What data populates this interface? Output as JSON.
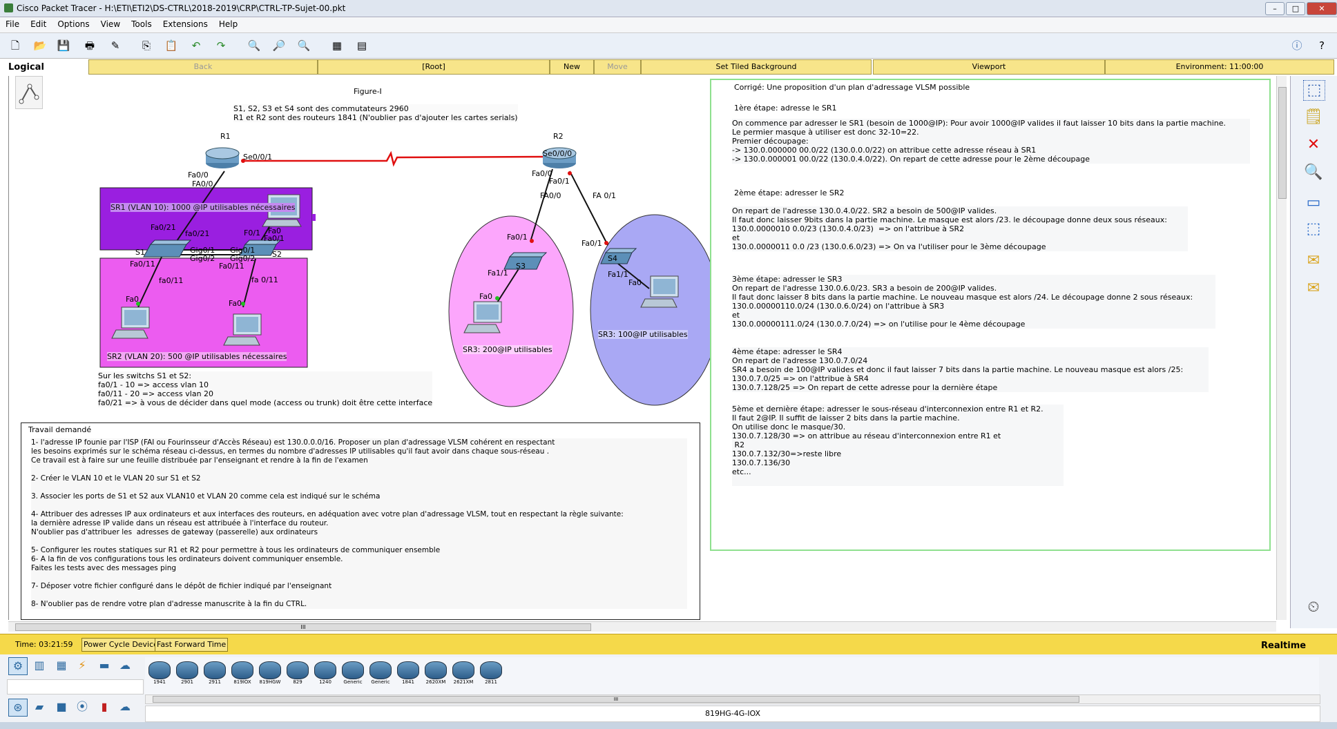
{
  "window": {
    "title": "Cisco Packet Tracer - H:\\ETI\\ETI2\\DS-CTRL\\2018-2019\\CRP\\CTRL-TP-Sujet-00.pkt",
    "minimize": "–",
    "maximize": "□",
    "close": "✕"
  },
  "menu": [
    "File",
    "Edit",
    "Options",
    "View",
    "Tools",
    "Extensions",
    "Help"
  ],
  "logical_bar": {
    "mode": "Logical",
    "back": "Back",
    "root": "[Root]",
    "new_cluster": "New Cluster",
    "move_object": "Move Object",
    "set_tiled_background": "Set Tiled Background",
    "viewport": "Viewport",
    "environment": "Environment: 11:00:00"
  },
  "diagram": {
    "figure_title": "Figure-I",
    "header_text": "S1, S2, S3 et S4 sont des commutateurs 2960\nR1 et R2 sont des routeurs 1841 (N'oublier pas d'ajouter les cartes serials)",
    "r1": "R1",
    "r2": "R2",
    "se001": "Se0/0/1",
    "se000": "Se0/0/0",
    "r1_fa00_a": "Fa0/0",
    "r1_fa00_b": "FA0/0",
    "r2_fa00_a": "Fa0/0",
    "r2_fa01_a": "Fa0/1",
    "r2_fa00_b": "FA0/0",
    "r2_fa01_b": "FA 0/1",
    "sr1": "SR1 (VLAN 10): 1000 @IP utilisables nécessaires",
    "sr2": "SR2 (VLAN 20): 500 @IP utilisables nécessaires",
    "s1": "S1",
    "s2": "S2",
    "s1_fa021": "Fa0/21",
    "s1_fa021b": "fa0/21",
    "f01": "F0/1",
    "fa0_pc": "Fa0",
    "fa01_s2": "Fa0/1",
    "gig01a": "Gig0/1",
    "gig02a": "Gig0/2",
    "gig01b": "Gig0/1",
    "gig02b": "Gig0/2",
    "s1_fa011": "Fa0/11",
    "s1_fa011b": "fa0/11",
    "s2_fa011": "Fa0/11",
    "s2_fa011b": "fa 0/11",
    "pc_fa0_1": "Fa0",
    "pc_fa0_2": "Fa0",
    "s3": "S3",
    "s3_fa01": "Fa0/1",
    "s3_fa11": "Fa1/1",
    "s3_pc_fa0": "Fa0",
    "sr3": "SR3: 200@IP utilisables",
    "s4": "S4",
    "s4_fa01": "Fa0/1",
    "s4_fa11": "Fa1/1",
    "s4_pc_fa0": "Fa0",
    "sr4": "SR3: 100@IP utilisables",
    "switch_note": "Sur les switchs S1 et S2:\nfa0/1 - 10 => access vlan 10\nfa0/11 - 20 => access vlan 20\nfa0/21 => à vous de décider dans quel mode (access ou trunk) doit être cette interface"
  },
  "task": {
    "title": "Travail demandé",
    "body": "1- l'adresse IP founie par l'ISP (FAI ou Fourinsseur d'Accès Réseau) est 130.0.0.0/16. Proposer un plan d'adressage VLSM cohérent en respectant\nles besoins exprimés sur le schéma réseau ci-dessus, en termes du nombre d'adresses IP utilisables qu'il faut avoir dans chaque sous-réseau .\nCe travail est à faire sur une feuille distribuée par l'enseignant et rendre à la fin de l'examen\n\n2- Créer le VLAN 10 et le VLAN 20 sur S1 et S2\n\n3. Associer les ports de S1 et S2 aux VLAN10 et VLAN 20 comme cela est indiqué sur le schéma\n\n4- Attribuer des adresses IP aux ordinateurs et aux interfaces des routeurs, en adéquation avec votre plan d'adressage VLSM, tout en respectant la règle suivante:\nla dernière adresse IP valide dans un réseau est attribuée à l'interface du routeur.\nN'oublier pas d'attribuer les  adresses de gateway (passerelle) aux ordinateurs\n\n5- Configurer les routes statiques sur R1 et R2 pour permettre à tous les ordinateurs de communiquer ensemble\n6- A la fin de vos configurations tous les ordinateurs doivent communiquer ensemble.\nFaites les tests avec des messages ping\n\n7- Déposer votre fichier configuré dans le dépôt de fichier indiqué par l'enseignant\n\n8- N'oublier pas de rendre votre plan d'adresse manuscrite à la fin du CTRL."
  },
  "correction": {
    "title": "Corrigé: Une proposition d'un plan d'adressage VLSM possible",
    "step1_title": "1ère étape: adresse le SR1",
    "step1": "On commence par adresser le SR1 (besoin de 1000@IP): Pour avoir 1000@IP valides il faut laisser 10 bits dans la partie machine.\nLe permier masque à utiliser est donc 32-10=22.\nPremier découpage:\n-> 130.0.000000 00.0/22 (130.0.0.0/22) on attribue cette adresse réseau à SR1\n-> 130.0.000001 00.0/22 (130.0.4.0/22). On repart de cette adresse pour le 2ème découpage",
    "step2_title": "2ème étape: adresser le SR2",
    "step2": "On repart de l'adresse 130.0.4.0/22. SR2 a besoin de 500@IP valides.\nIl faut donc laisser 9bits dans la partie machine. Le masque est alors /23. le découpage donne deux sous réseaux:\n130.0.0000010 0.0/23 (130.0.4.0/23)  => on l'attribue à SR2\net\n130.0.0000011 0.0 /23 (130.0.6.0/23) => On va l'utiliser pour le 3ème découpage",
    "step3": "3ème étape: adresser le SR3\nOn repart de l'adresse 130.0.6.0/23. SR3 a besoin de 200@IP valides.\nIl faut donc laisser 8 bits dans la partie machine. Le nouveau masque est alors /24. Le découpage donne 2 sous réseaux:\n130.0.00000110.0/24 (130.0.6.0/24) on l'attribue à SR3\net\n130.0.00000111.0/24 (130.0.7.0/24) => on l'utilise pour le 4ème découpage",
    "step4": "4ème étape: adresser le SR4\nOn repart de l'adresse 130.0.7.0/24\nSR4 a besoin de 100@IP valides et donc il faut laisser 7 bits dans la partie machine. Le nouveau masque est alors /25:\n130.0.7.0/25 => on l'attribue à SR4\n130.0.7.128/25 => On repart de cette adresse pour la dernière étape",
    "step5": "5ème et dernière étape: adresser le sous-réseau d'interconnexion entre R1 et R2.\nIl faut 2@IP. Il suffit de laisser 2 bits dans la partie machine.\nOn utilise donc le masque/30.\n130.0.7.128/30 => on attribue au réseau d'interconnexion entre R1 et\n R2\n130.0.7.132/30=>reste libre\n130.0.7.136/30\netc..."
  },
  "timebar": {
    "time": "Time: 03:21:59",
    "power_cycle": "Power Cycle Devices",
    "fast_forward": "Fast Forward Time",
    "realtime": "Realtime"
  },
  "devices": [
    "1941",
    "2901",
    "2911",
    "819IOX",
    "819HGW",
    "829",
    "1240",
    "Generic",
    "Generic",
    "1841",
    "2620XM",
    "2621XM",
    "2811"
  ],
  "selected_device": "819HG-4G-IOX",
  "scroll_marker": "III"
}
